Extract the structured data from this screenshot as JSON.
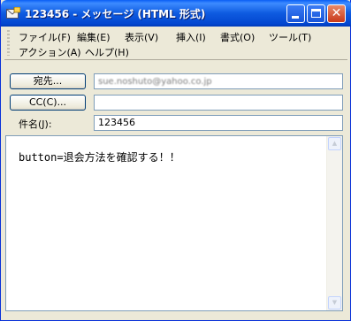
{
  "window": {
    "title": "123456 - メッセージ (HTML 形式)",
    "controls": {
      "minimize": "minimize",
      "maximize": "maximize",
      "close": "✕"
    }
  },
  "menu": {
    "row1": [
      "ファイル(F)",
      "編集(E)",
      "表示(V)",
      "挿入(I)",
      "書式(O)",
      "ツール(T)"
    ],
    "row2": [
      "アクション(A)",
      "ヘルプ(H)"
    ]
  },
  "fields": {
    "to_button": "宛先...",
    "to_value": "sue.noshuto@yahoo.co.jp",
    "cc_button": "CC(C)...",
    "cc_value": "",
    "subject_label": "件名(J):",
    "subject_value": "123456"
  },
  "body": {
    "text": "button=退会方法を確認する！！"
  },
  "icons": {
    "app": "mail-envelope-icon",
    "scroll_up": "scroll-up-arrow-icon",
    "scroll_down": "scroll-down-arrow-icon"
  }
}
